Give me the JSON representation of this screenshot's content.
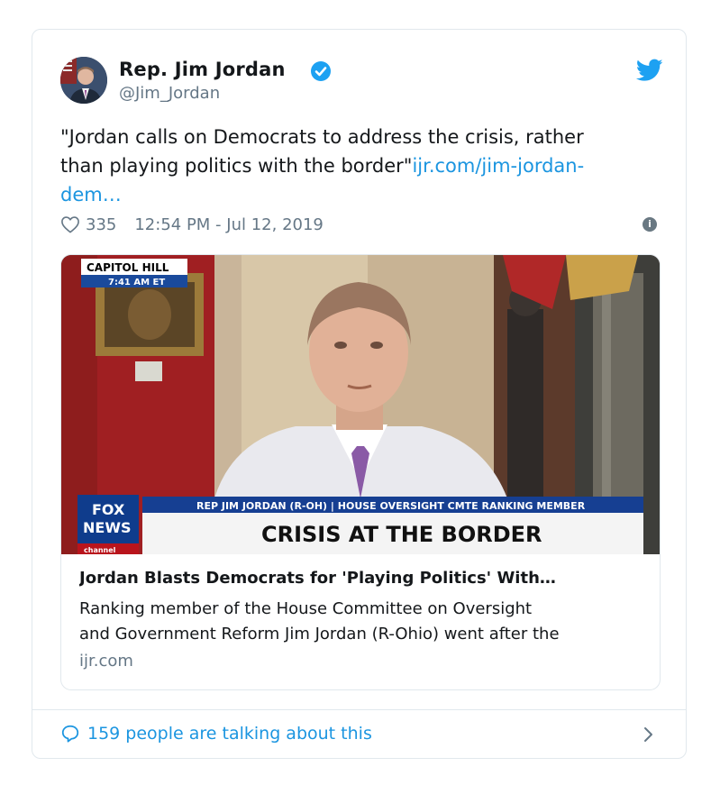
{
  "author": {
    "name": "Rep. Jim Jordan",
    "handle": "@Jim_Jordan",
    "verified_icon": "verified-badge-icon"
  },
  "tweet": {
    "text_line1": "\"Jordan calls on Democrats to address the crisis, rather",
    "text_line2": "than playing politics with the border\"",
    "link_text": "ijr.com/jim-jordan-",
    "link_text2": "dem…"
  },
  "meta": {
    "likes": "335",
    "timestamp": "12:54 PM - Jul 12, 2019"
  },
  "link_card": {
    "image_overlay": {
      "location_tag": "CAPITOL HILL",
      "time_tag": "7:41 AM ET",
      "chyron_small": "REP JIM JORDAN (R-OH) | HOUSE OVERSIGHT CMTE RANKING MEMBER",
      "chyron_big": "CRISIS AT THE BORDER",
      "logo_line1": "FOX",
      "logo_line2": "NEWS",
      "logo_line3": "channel"
    },
    "title": "Jordan Blasts Democrats for 'Playing Politics' With…",
    "description_line1": "Ranking member of the House Committee on Oversight",
    "description_line2": "and Government Reform Jim Jordan (R-Ohio) went after the",
    "domain": "ijr.com"
  },
  "footer": {
    "talking": "159 people are talking about this"
  },
  "colors": {
    "link": "#1b95e0",
    "muted": "#657786",
    "border": "#e1e8ed",
    "fox_blue": "#123e8a"
  }
}
